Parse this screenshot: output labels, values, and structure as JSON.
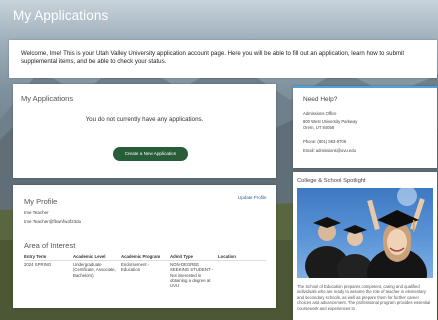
{
  "page_title": "My Applications",
  "welcome": {
    "text": "Welcome, Ime! This is your Utah Valley University application account page. Here you will be able to fill out an application, learn how to submit supplemental items, and be able to check your status."
  },
  "applications": {
    "heading": "My Applications",
    "empty_message": "You do not currently have any applications.",
    "create_button": "Create a New Application"
  },
  "profile": {
    "heading": "My Profile",
    "update_link": "Update Profile",
    "name": "Ime Teacher",
    "email": "Ime.Teacher@fbwnfw4f23du"
  },
  "area_of_interest": {
    "heading": "Area of Interest",
    "columns": [
      "Entry Term",
      "Academic Level",
      "Academic Program",
      "Admit Type",
      "Location"
    ],
    "row": {
      "entry_term": "2024 SPRING",
      "academic_level": "Undergraduate (Certificate, Associate, Bachelors)",
      "academic_program": "Endorsement - Education",
      "admit_type": "NON-DEGREE SEEKING STUDENT - Not interested in obtaining a degree at UVU",
      "location": ""
    }
  },
  "help": {
    "heading": "Need Help?",
    "office": "Admissions Office",
    "address1": "800 West University Parkway",
    "address2": "Orem, UT 84058",
    "phone": "Phone: (801) 863-8706",
    "email": "Email: admissions@uvu.edu"
  },
  "spotlight": {
    "heading": "College & School Spotlight",
    "description": "The School of Education prepares competent, caring and qualified individuals who are ready to assume the role of teacher in elementary and secondary schools, as well as prepare them for further career choices and advancement. The professional program provides essential coursework and experiences to"
  },
  "colors": {
    "button": "#275d38",
    "link": "#2e5f9e",
    "accent": "#4aa3df"
  }
}
